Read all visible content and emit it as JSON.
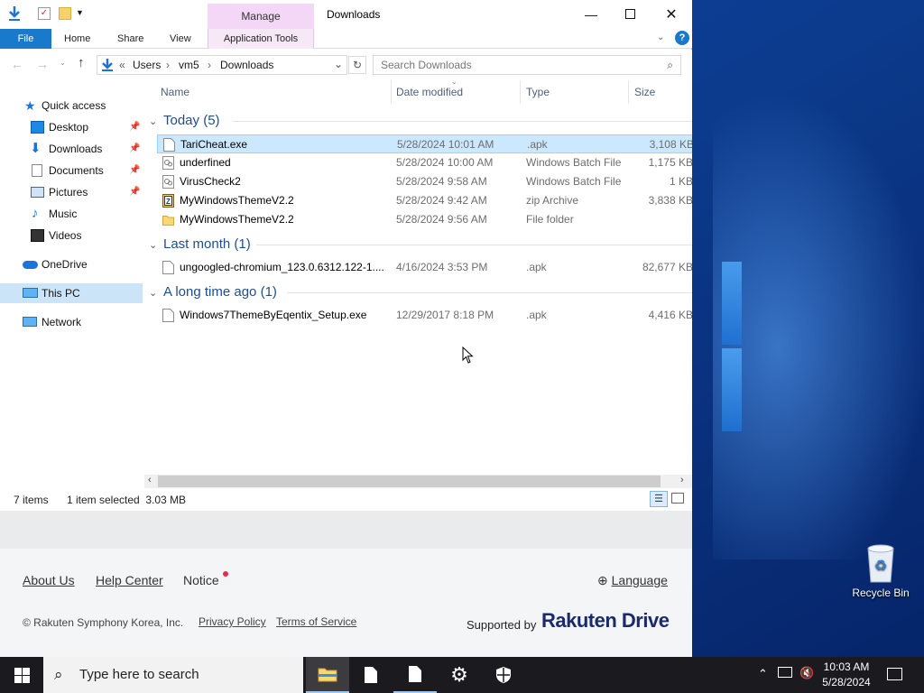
{
  "explorer": {
    "title": "Downloads",
    "manage_label": "Manage",
    "ribbon_tabs": [
      "File",
      "Home",
      "Share",
      "View",
      "Application Tools"
    ],
    "address": {
      "breadcrumb": [
        "Users",
        "vm5",
        "Downloads"
      ],
      "prefix": "«"
    },
    "search_placeholder": "Search Downloads",
    "columns": {
      "name": "Name",
      "date": "Date modified",
      "type": "Type",
      "size": "Size"
    },
    "nav": [
      {
        "label": "Quick access",
        "icon": "star-icon"
      },
      {
        "label": "Desktop",
        "icon": "desktop-folder-icon",
        "pinned": true
      },
      {
        "label": "Downloads",
        "icon": "download-folder-icon",
        "pinned": true
      },
      {
        "label": "Documents",
        "icon": "documents-folder-icon",
        "pinned": true
      },
      {
        "label": "Pictures",
        "icon": "pictures-folder-icon",
        "pinned": true
      },
      {
        "label": "Music",
        "icon": "music-folder-icon"
      },
      {
        "label": "Videos",
        "icon": "videos-folder-icon"
      },
      {
        "label": "OneDrive",
        "icon": "onedrive-icon"
      },
      {
        "label": "This PC",
        "icon": "computer-icon",
        "selected": true
      },
      {
        "label": "Network",
        "icon": "network-icon"
      }
    ],
    "groups": [
      {
        "label": "Today (5)",
        "files": [
          {
            "name": "TariCheat.exe",
            "date": "5/28/2024 10:01 AM",
            "type": ".apk",
            "size": "3,108 KB",
            "icon": "file-icon",
            "selected": true
          },
          {
            "name": "underfined",
            "date": "5/28/2024 10:00 AM",
            "type": "Windows Batch File",
            "size": "1,175 KB",
            "icon": "batch-file-icon"
          },
          {
            "name": "VirusCheck2",
            "date": "5/28/2024 9:58 AM",
            "type": "Windows Batch File",
            "size": "1 KB",
            "icon": "batch-file-icon"
          },
          {
            "name": "MyWindowsThemeV2.2",
            "date": "5/28/2024 9:42 AM",
            "type": "zip Archive",
            "size": "3,838 KB",
            "icon": "zip-archive-icon"
          },
          {
            "name": "MyWindowsThemeV2.2",
            "date": "5/28/2024 9:56 AM",
            "type": "File folder",
            "size": "",
            "icon": "folder-icon"
          }
        ]
      },
      {
        "label": "Last month (1)",
        "files": [
          {
            "name": "ungoogled-chromium_123.0.6312.122-1....",
            "date": "4/16/2024 3:53 PM",
            "type": ".apk",
            "size": "82,677 KB",
            "icon": "file-icon"
          }
        ]
      },
      {
        "label": "A long time ago (1)",
        "files": [
          {
            "name": "Windows7ThemeByEqentix_Setup.exe",
            "date": "12/29/2017 8:18 PM",
            "type": ".apk",
            "size": "4,416 KB",
            "icon": "file-icon"
          }
        ]
      }
    ],
    "status": {
      "items": "7 items",
      "selected": "1 item selected  3.03 MB"
    }
  },
  "webpage": {
    "links": [
      "About Us",
      "Help Center",
      "Notice"
    ],
    "language": "Language",
    "copyright": "© Rakuten Symphony Korea, Inc.",
    "policy_links": [
      "Privacy Policy",
      "Terms of Service"
    ],
    "supported_by": "Supported by",
    "brand": "Rakuten Drive"
  },
  "desktop": {
    "recycle_bin": "Recycle Bin"
  },
  "taskbar": {
    "search_placeholder": "Type here to search",
    "time": "10:03 AM",
    "date": "5/28/2024"
  },
  "colors": {
    "accent": "#1979ca",
    "selection": "#cce8ff",
    "manage_tab": "#f4d7f6",
    "desktop": "#0c3a8c",
    "taskbar": "#1b1b1f"
  }
}
